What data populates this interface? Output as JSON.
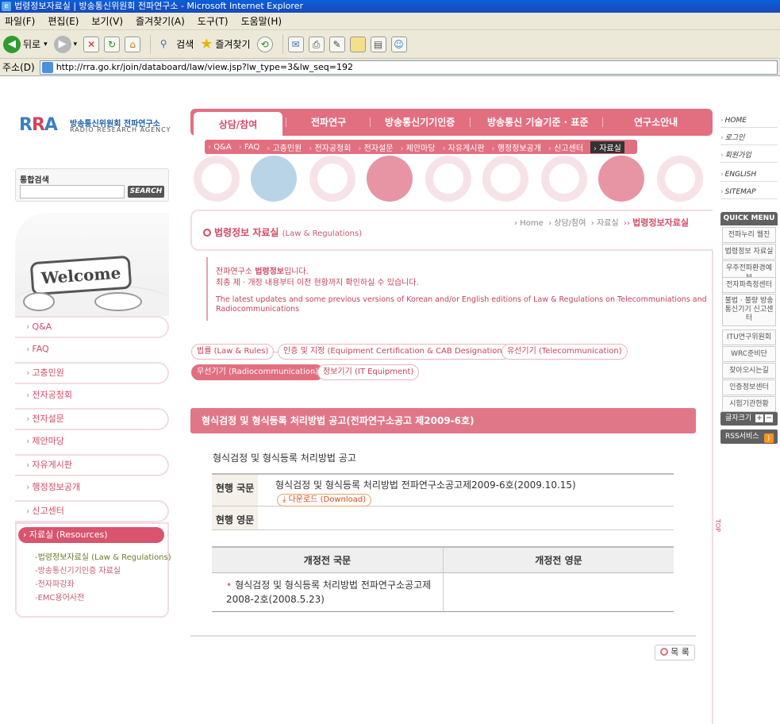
{
  "window": {
    "title": "법령정보자료실 | 방송통신위원회 전파연구소 - Microsoft Internet Explorer"
  },
  "menubar": [
    "파일(F)",
    "편집(E)",
    "보기(V)",
    "즐겨찾기(A)",
    "도구(T)",
    "도움말(H)"
  ],
  "toolbar": {
    "back": "뒤로",
    "search": "검색",
    "favorites": "즐겨찾기"
  },
  "address": {
    "label": "주소(D)",
    "url": "http://rra.go.kr/join/databoard/law/view.jsp?lw_type=3&lw_seq=192"
  },
  "logo": {
    "mark": "RRA",
    "korean": "방송통신위원회 전파연구소",
    "english": "RADIO RESEARCH AGENCY"
  },
  "search": {
    "label": "통합검색",
    "button": "SEARCH"
  },
  "welcome": {
    "text": "Welcome"
  },
  "leftnav": {
    "items": [
      "Q&A",
      "FAQ",
      "고충민원",
      "전자공청회",
      "전자설문",
      "제안마당",
      "자유게시판",
      "행정정보공개",
      "신고센터"
    ],
    "active": "자료실 (Resources)",
    "sub": [
      "-법령정보자료실 (Law & Regulations)",
      "-방송통신기기인증 자료실",
      "-전자파강좌",
      "-EMC용어사전"
    ]
  },
  "topnav": {
    "tabs": [
      "상담/참여",
      "전파연구",
      "방송통신기기인증",
      "방송통신 기술기준 · 표준",
      "연구소안내"
    ],
    "sub": [
      "Q&A",
      "FAQ",
      "고충민원",
      "전자공청회",
      "전자설문",
      "제안마당",
      "자유게시판",
      "행정정보공개",
      "신고센터",
      "자료실"
    ]
  },
  "page": {
    "title": "법령정보 자료실",
    "title_en": "(Law & Regulations)",
    "breadcrumb": [
      "Home",
      "상담/참여",
      "자료실"
    ],
    "breadcrumb_current": "법령정보자료실",
    "intro_line1_pre": "전파연구소 ",
    "intro_line1_hl": "법령정보",
    "intro_line1_post": "입니다.",
    "intro_line2": "최종 제 · 개정 내용부터 이전 현황까지 확인하실 수 있습니다.",
    "intro_en": "The latest updates and some previous versions of Korean and/or English editions of Law & Regulations on Telecommuniations and Radiocommunications"
  },
  "categories": [
    "법률 (Law & Rules)",
    "인증 및 지정 (Equipment Certification & CAB Designation)",
    "유선기기 (Telecommunication)",
    "무선기기 (Radiocommunication)",
    "정보기기 (IT Equipment)"
  ],
  "announcement": {
    "heading": "형식검정 및 형식등록 처리방법 공고(전파연구소공고 제2009-6호)",
    "subtitle": "형식검정 및 형식등록 처리방법 공고",
    "current_ko_label": "현행 국문",
    "current_ko_value": "형식검정 및 형식등록 처리방법 전파연구소공고제2009-6호(2009.10.15)",
    "download": "다운로드 (Download)",
    "current_en_label": "현행 영문",
    "current_en_value": "",
    "prev_ko_header": "개정전 국문",
    "prev_en_header": "개정전 영문",
    "prev_ko_value": "형식검정 및 형식등록 처리방법 전파연구소공고제2008-2호(2008.5.23)",
    "prev_en_value": ""
  },
  "list_button": "목 록",
  "right": {
    "links": [
      "HOME",
      "로그인",
      "회원가입",
      "ENGLISH",
      "SITEMAP"
    ],
    "quick_menu": "QUICK MENU",
    "quick": [
      "전파누리 웹진",
      "법령정보 자료실",
      "우주전파환경예보",
      "전자파측정센터",
      "불법 · 불량 방송통신기기 신고센터",
      "ITU연구위원회",
      "WRC준비단",
      "찾아오시는길",
      "인증정보센터",
      "시험기관현황"
    ],
    "font_size": "글자크기",
    "rss": "RSS서비스",
    "top": "TOP"
  },
  "colors": {
    "accent": "#e26f80",
    "title_bar": "#0a5fd8"
  }
}
